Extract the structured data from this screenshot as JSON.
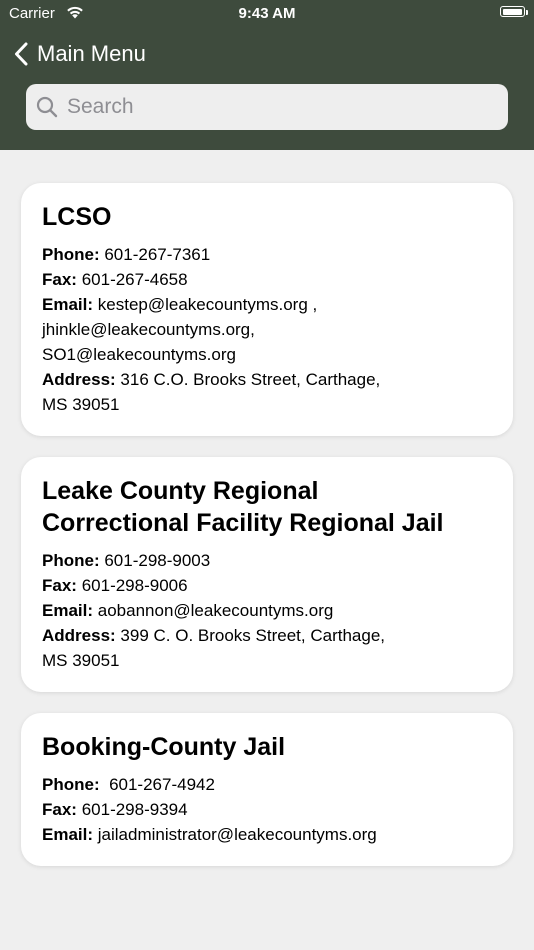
{
  "status_bar": {
    "carrier": "Carrier",
    "time": "9:43 AM",
    "battery_level": 0.95
  },
  "nav": {
    "back_label": "Main Menu"
  },
  "search": {
    "placeholder": "Search"
  },
  "colors": {
    "header_bg": "#3e4b3d",
    "page_bg": "#efefef",
    "card_bg": "#ffffff"
  },
  "contacts": [
    {
      "name": "LCSO",
      "phone_label": "Phone:",
      "phone": "601-267-7361",
      "fax_label": "Fax:",
      "fax": "601-267-4658",
      "email_label": "Email:",
      "email_line1": "kestep@leakecountyms.org ,",
      "email_line2": "jhinkle@leakecountyms.org,",
      "email_line3": "SO1@leakecountyms.org",
      "address_label": "Address:",
      "address_line1": "316 C.O. Brooks Street, Carthage,",
      "address_line2": "MS 39051"
    },
    {
      "name_line1": "Leake County Regional",
      "name_line2": "Correctional Facility Regional Jail",
      "phone_label": "Phone:",
      "phone": "601-298-9003",
      "fax_label": "Fax:",
      "fax": "601-298-9006",
      "email_label": "Email:",
      "email": "aobannon@leakecountyms.org",
      "address_label": "Address:",
      "address_line1": "399 C. O. Brooks Street, Carthage,",
      "address_line2": "MS 39051"
    },
    {
      "name": "Booking-County Jail",
      "phone_label": "Phone:",
      "phone": " 601-267-4942",
      "fax_label": "Fax:",
      "fax": "601-298-9394",
      "email_label": "Email:",
      "email": "jailadministrator@leakecountyms.org"
    }
  ]
}
